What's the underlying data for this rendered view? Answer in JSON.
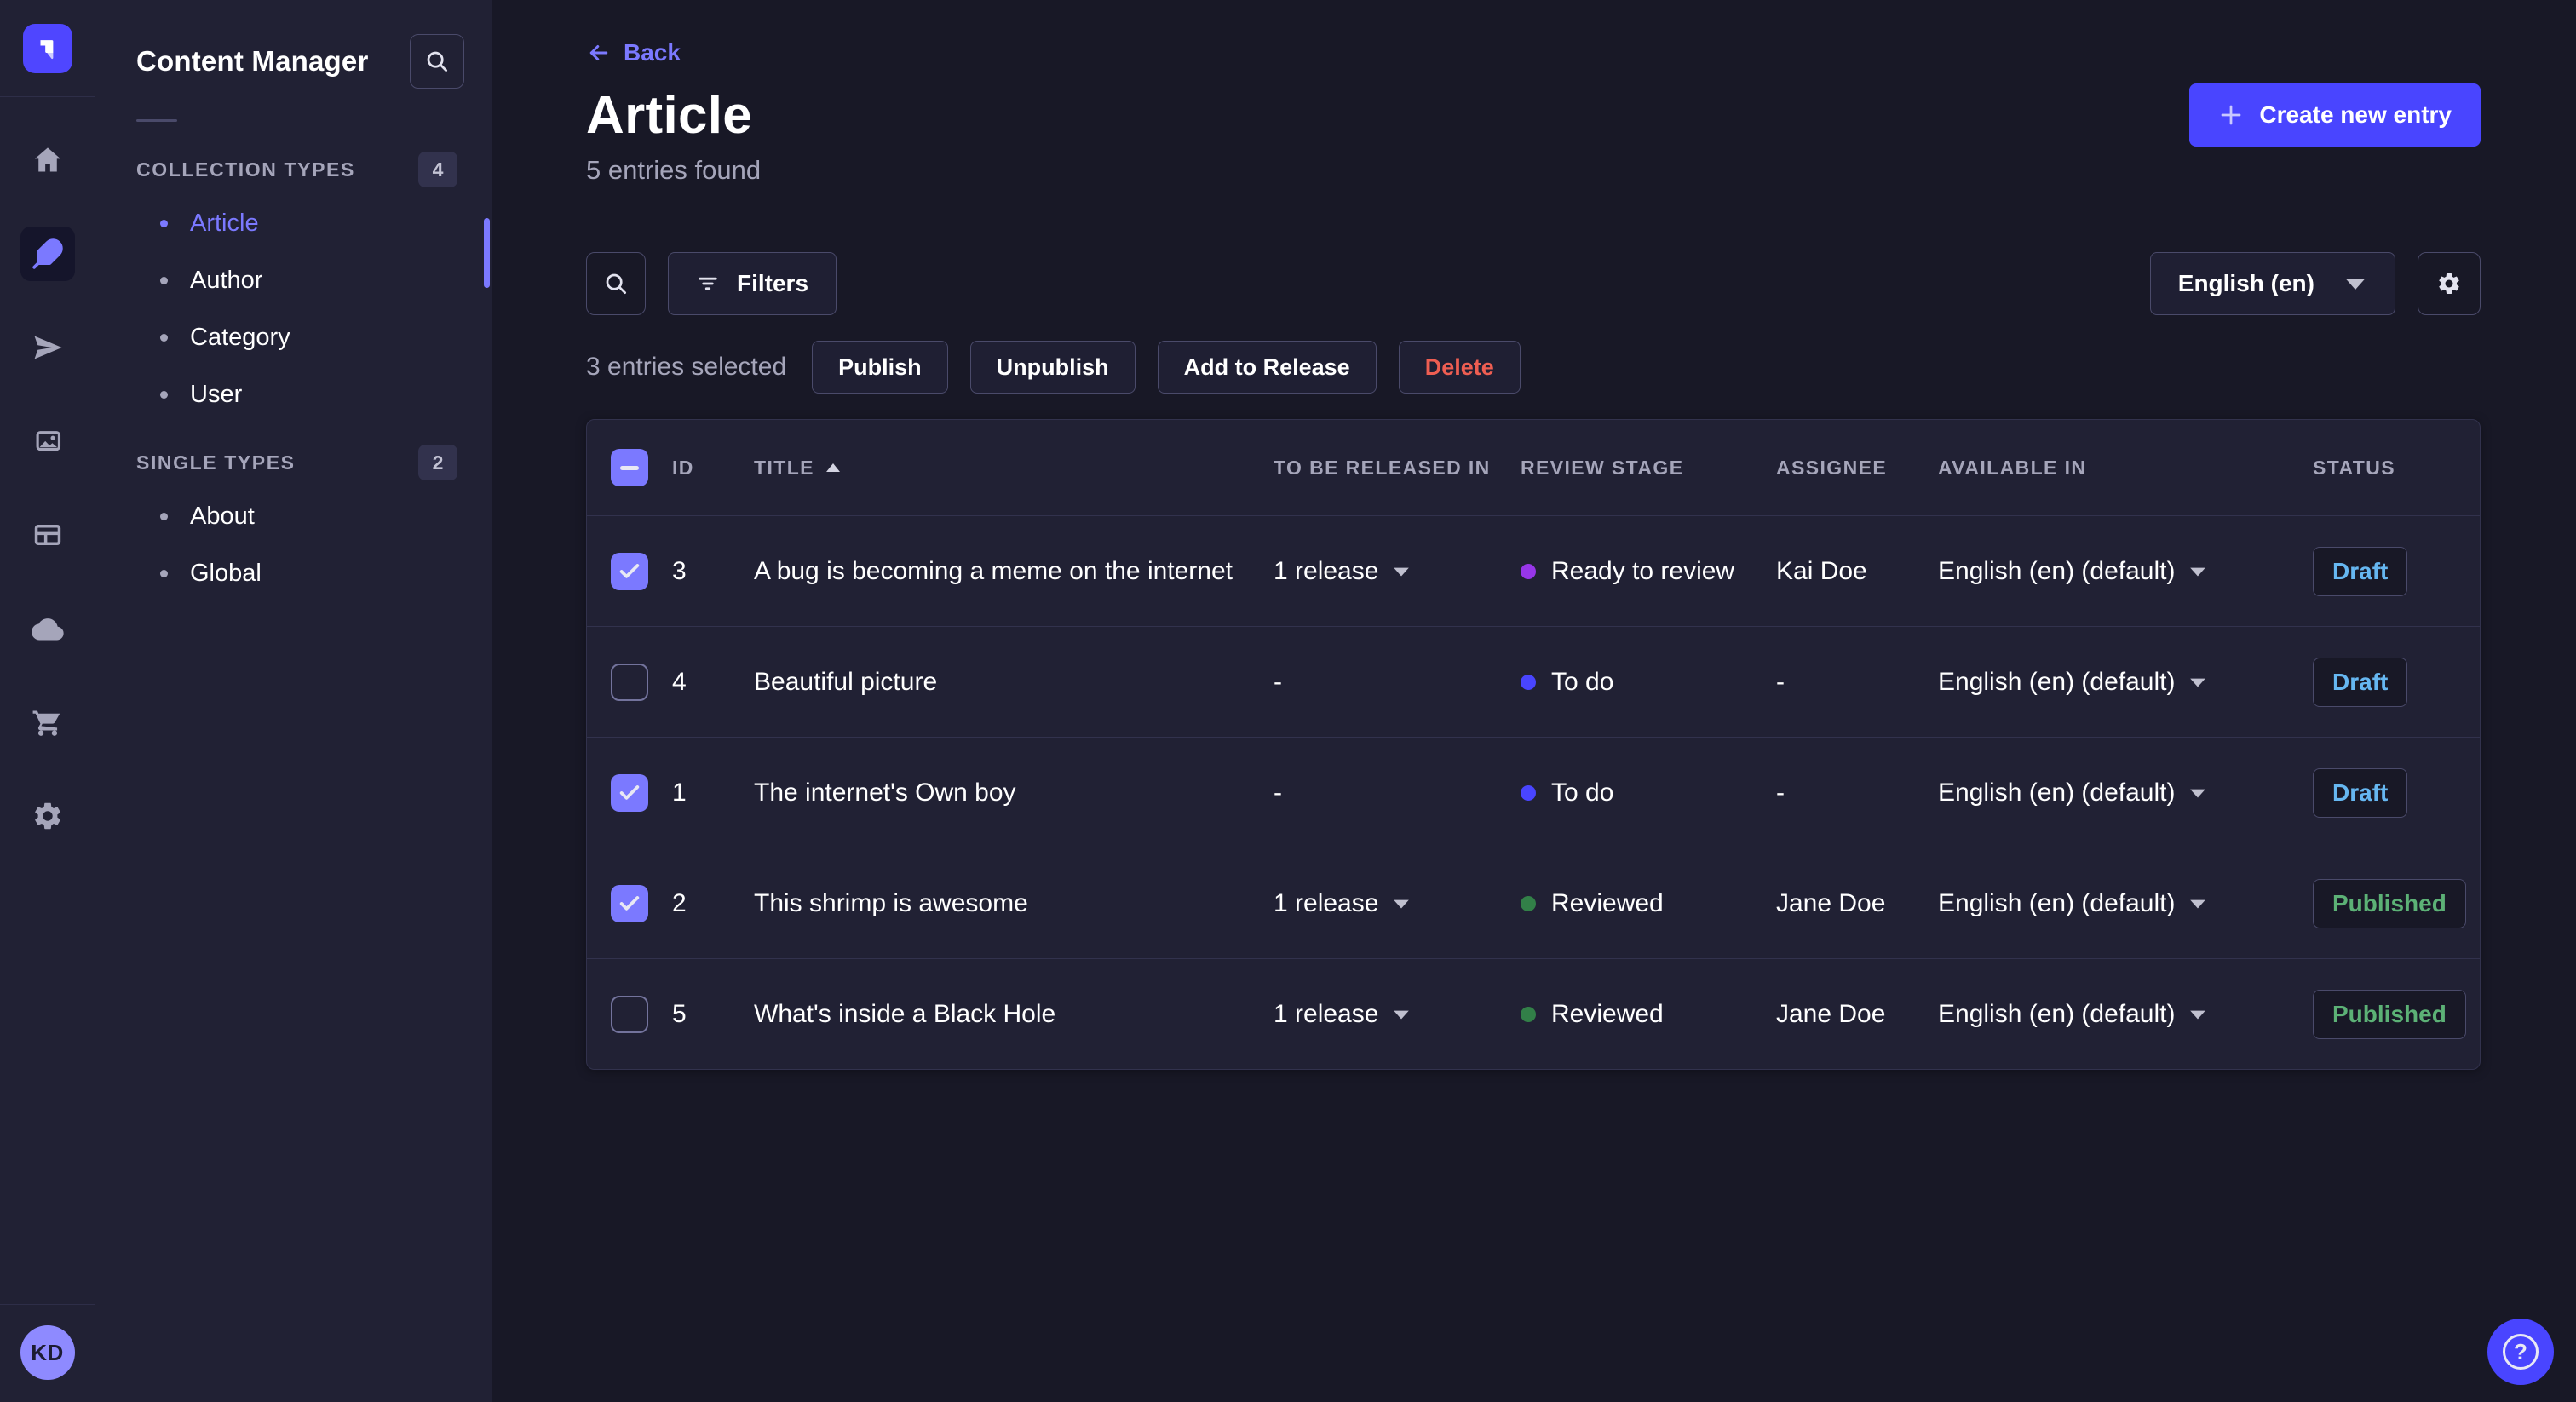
{
  "sidebar": {
    "title": "Content Manager",
    "sections": [
      {
        "label": "COLLECTION TYPES",
        "count": "4",
        "items": [
          {
            "label": "Article",
            "active": true
          },
          {
            "label": "Author",
            "active": false
          },
          {
            "label": "Category",
            "active": false
          },
          {
            "label": "User",
            "active": false
          }
        ]
      },
      {
        "label": "SINGLE TYPES",
        "count": "2",
        "items": [
          {
            "label": "About",
            "active": false
          },
          {
            "label": "Global",
            "active": false
          }
        ]
      }
    ]
  },
  "rail": {
    "icons": [
      "home",
      "feather-content-manager",
      "paper-plane",
      "media-library",
      "layout",
      "cloud",
      "cart",
      "settings"
    ],
    "active_icon": "feather-content-manager",
    "avatar_initials": "KD"
  },
  "page": {
    "back_label": "Back",
    "title": "Article",
    "subtitle": "5 entries found",
    "create_button": "Create new entry"
  },
  "toolbar": {
    "filters_button": "Filters",
    "locale_select": "English (en)"
  },
  "selection": {
    "summary": "3 entries selected",
    "publish": "Publish",
    "unpublish": "Unpublish",
    "add_to_release": "Add to Release",
    "delete": "Delete"
  },
  "table": {
    "headers": {
      "id": "ID",
      "title": "TITLE",
      "to_be_released_in": "TO BE RELEASED IN",
      "review_stage": "REVIEW STAGE",
      "assignee": "ASSIGNEE",
      "available_in": "AVAILABLE IN",
      "status": "STATUS"
    },
    "sort": {
      "column": "TITLE",
      "direction": "ascending"
    },
    "rows": [
      {
        "checked": true,
        "id": "3",
        "title": "A bug is becoming a meme on the internet",
        "release": "1 release",
        "review": {
          "label": "Ready to review",
          "color": "#9736e8"
        },
        "assignee": "Kai Doe",
        "locale": "English (en) (default)",
        "status": {
          "label": "Draft",
          "color": "#66b7f1"
        }
      },
      {
        "checked": false,
        "id": "4",
        "title": "Beautiful picture",
        "release": "-",
        "review": {
          "label": "To do",
          "color": "#4945ff"
        },
        "assignee": "-",
        "locale": "English (en) (default)",
        "status": {
          "label": "Draft",
          "color": "#66b7f1"
        }
      },
      {
        "checked": true,
        "id": "1",
        "title": "The internet's Own boy",
        "release": "-",
        "review": {
          "label": "To do",
          "color": "#4945ff"
        },
        "assignee": "-",
        "locale": "English (en) (default)",
        "status": {
          "label": "Draft",
          "color": "#66b7f1"
        }
      },
      {
        "checked": true,
        "id": "2",
        "title": "This shrimp is awesome",
        "release": "1 release",
        "review": {
          "label": "Reviewed",
          "color": "#328048"
        },
        "assignee": "Jane Doe",
        "locale": "English (en) (default)",
        "status": {
          "label": "Published",
          "color": "#5cb176"
        }
      },
      {
        "checked": false,
        "id": "5",
        "title": "What's inside a Black Hole",
        "release": "1 release",
        "review": {
          "label": "Reviewed",
          "color": "#328048"
        },
        "assignee": "Jane Doe",
        "locale": "English (en) (default)",
        "status": {
          "label": "Published",
          "color": "#5cb176"
        }
      }
    ]
  },
  "colors": {
    "background": "#181826",
    "surface": "#212134",
    "border": "#32324d",
    "border_light": "#4a4a6a",
    "accent": "#4945ff",
    "accent_light": "#7b79ff",
    "text_primary": "#ffffff",
    "text_secondary": "#a5a5ba",
    "danger": "#ee5e52",
    "success": "#5cb176",
    "draft_blue": "#66b7f1"
  }
}
